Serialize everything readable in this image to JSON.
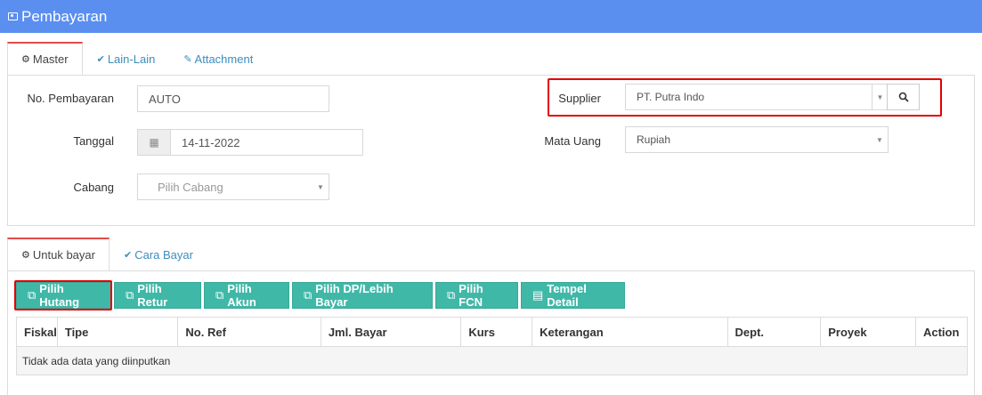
{
  "header": {
    "title": "Pembayaran",
    "icon": "money-icon"
  },
  "top_tabs": [
    {
      "label": "Master",
      "icon": "cogs-icon",
      "active": true
    },
    {
      "label": "Lain-Lain",
      "icon": "check-circle-icon",
      "active": false
    },
    {
      "label": "Attachment",
      "icon": "paperclip-icon",
      "active": false
    }
  ],
  "form": {
    "no_pembayaran_label": "No. Pembayaran",
    "no_pembayaran_value": "AUTO",
    "tanggal_label": "Tanggal",
    "tanggal_value": "14-11-2022",
    "cabang_label": "Cabang",
    "cabang_placeholder": "Pilih Cabang",
    "supplier_label": "Supplier",
    "supplier_value": "PT. Putra Indo",
    "mata_uang_label": "Mata Uang",
    "mata_uang_value": "Rupiah"
  },
  "bottom_tabs": [
    {
      "label": "Untuk bayar",
      "icon": "cogs-icon",
      "active": true
    },
    {
      "label": "Cara Bayar",
      "icon": "check-circle-icon",
      "active": false
    }
  ],
  "buttons": [
    "Pilih Hutang",
    "Pilih Retur",
    "Pilih Akun",
    "Pilih DP/Lebih Bayar",
    "Pilih FCN",
    "Tempel Detail"
  ],
  "table": {
    "columns": [
      "Fiskal",
      "Tipe",
      "No. Ref",
      "Jml. Bayar",
      "Kurs",
      "Keterangan",
      "Dept.",
      "Proyek",
      "Action"
    ],
    "empty_message": "Tidak ada data yang diinputkan"
  },
  "colors": {
    "header_bg": "#5a8ff0",
    "button_bg": "#40b8a8",
    "highlight": "#e30000",
    "link": "#3c8dbc"
  }
}
